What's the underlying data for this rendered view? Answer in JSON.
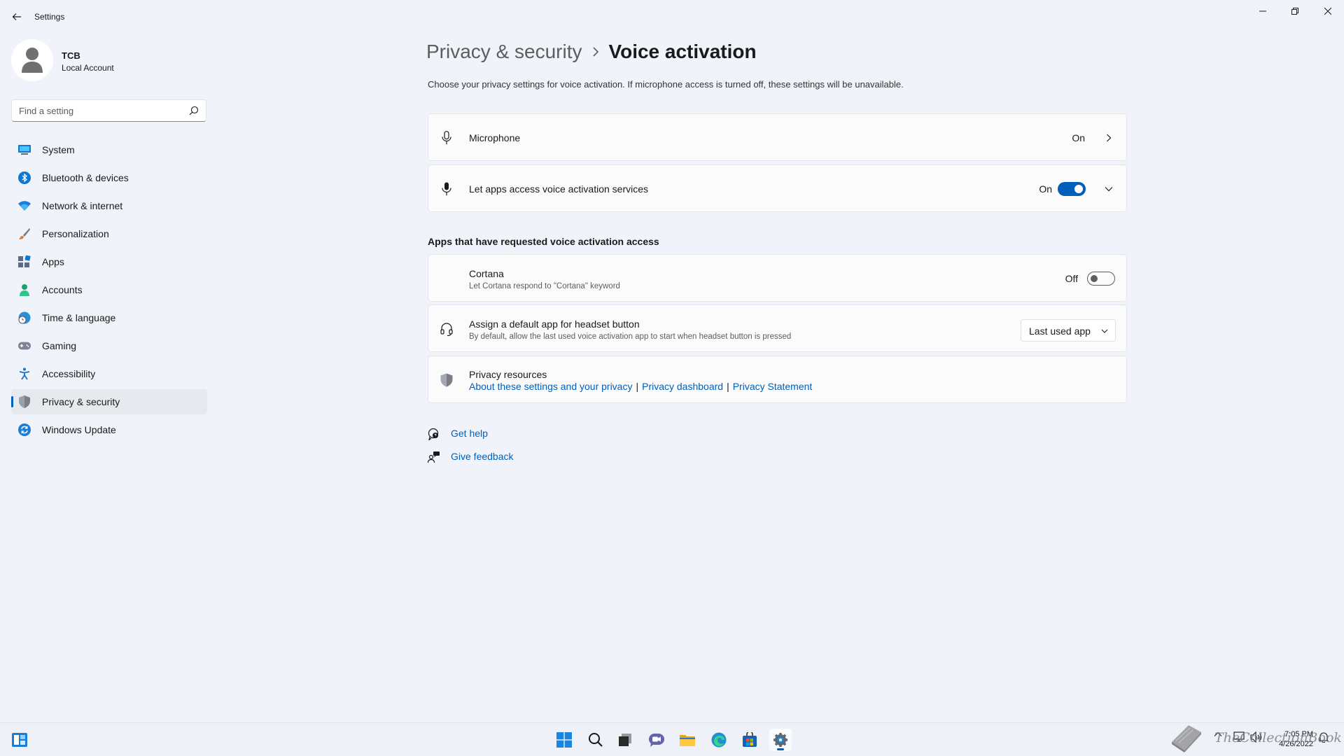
{
  "window": {
    "app_title": "Settings"
  },
  "profile": {
    "name": "TCB",
    "account_type": "Local Account"
  },
  "search": {
    "placeholder": "Find a setting"
  },
  "sidebar": {
    "items": [
      {
        "label": "System",
        "icon": "system-icon"
      },
      {
        "label": "Bluetooth & devices",
        "icon": "bluetooth-icon"
      },
      {
        "label": "Network & internet",
        "icon": "wifi-icon"
      },
      {
        "label": "Personalization",
        "icon": "brush-icon"
      },
      {
        "label": "Apps",
        "icon": "apps-icon"
      },
      {
        "label": "Accounts",
        "icon": "person-icon"
      },
      {
        "label": "Time & language",
        "icon": "globe-clock-icon"
      },
      {
        "label": "Gaming",
        "icon": "gamepad-icon"
      },
      {
        "label": "Accessibility",
        "icon": "accessibility-icon"
      },
      {
        "label": "Privacy & security",
        "icon": "shield-icon",
        "active": true
      },
      {
        "label": "Windows Update",
        "icon": "update-icon"
      }
    ]
  },
  "main": {
    "breadcrumb_parent": "Privacy & security",
    "breadcrumb_current": "Voice activation",
    "description": "Choose your privacy settings for voice activation. If microphone access is turned off, these settings will be unavailable.",
    "microphone": {
      "title": "Microphone",
      "state": "On"
    },
    "voice_services": {
      "title": "Let apps access voice activation services",
      "state": "On",
      "toggle_on": true
    },
    "section_header": "Apps that have requested voice activation access",
    "cortana": {
      "title": "Cortana",
      "subtitle": "Let Cortana respond to \"Cortana\" keyword",
      "state": "Off",
      "toggle_on": false
    },
    "headset": {
      "title": "Assign a default app for headset button",
      "subtitle": "By default, allow the last used voice activation app to start when headset button is pressed",
      "selected": "Last used app"
    },
    "privacy_resources": {
      "title": "Privacy resources",
      "links": [
        "About these settings and your privacy",
        "Privacy dashboard",
        "Privacy Statement"
      ],
      "separator": "|"
    },
    "get_help": "Get help",
    "give_feedback": "Give feedback"
  },
  "taskbar": {
    "apps": [
      "start-icon",
      "search-icon",
      "task-view-icon",
      "chat-icon",
      "file-explorer-icon",
      "edge-icon",
      "store-icon",
      "settings-icon"
    ],
    "time": "7:05 PM",
    "date": "4/26/2022"
  },
  "watermark": {
    "text": "TheCollectionBook"
  },
  "colors": {
    "accent": "#005fb8",
    "background": "#f0f3f9",
    "card": "#fbfbfc"
  }
}
